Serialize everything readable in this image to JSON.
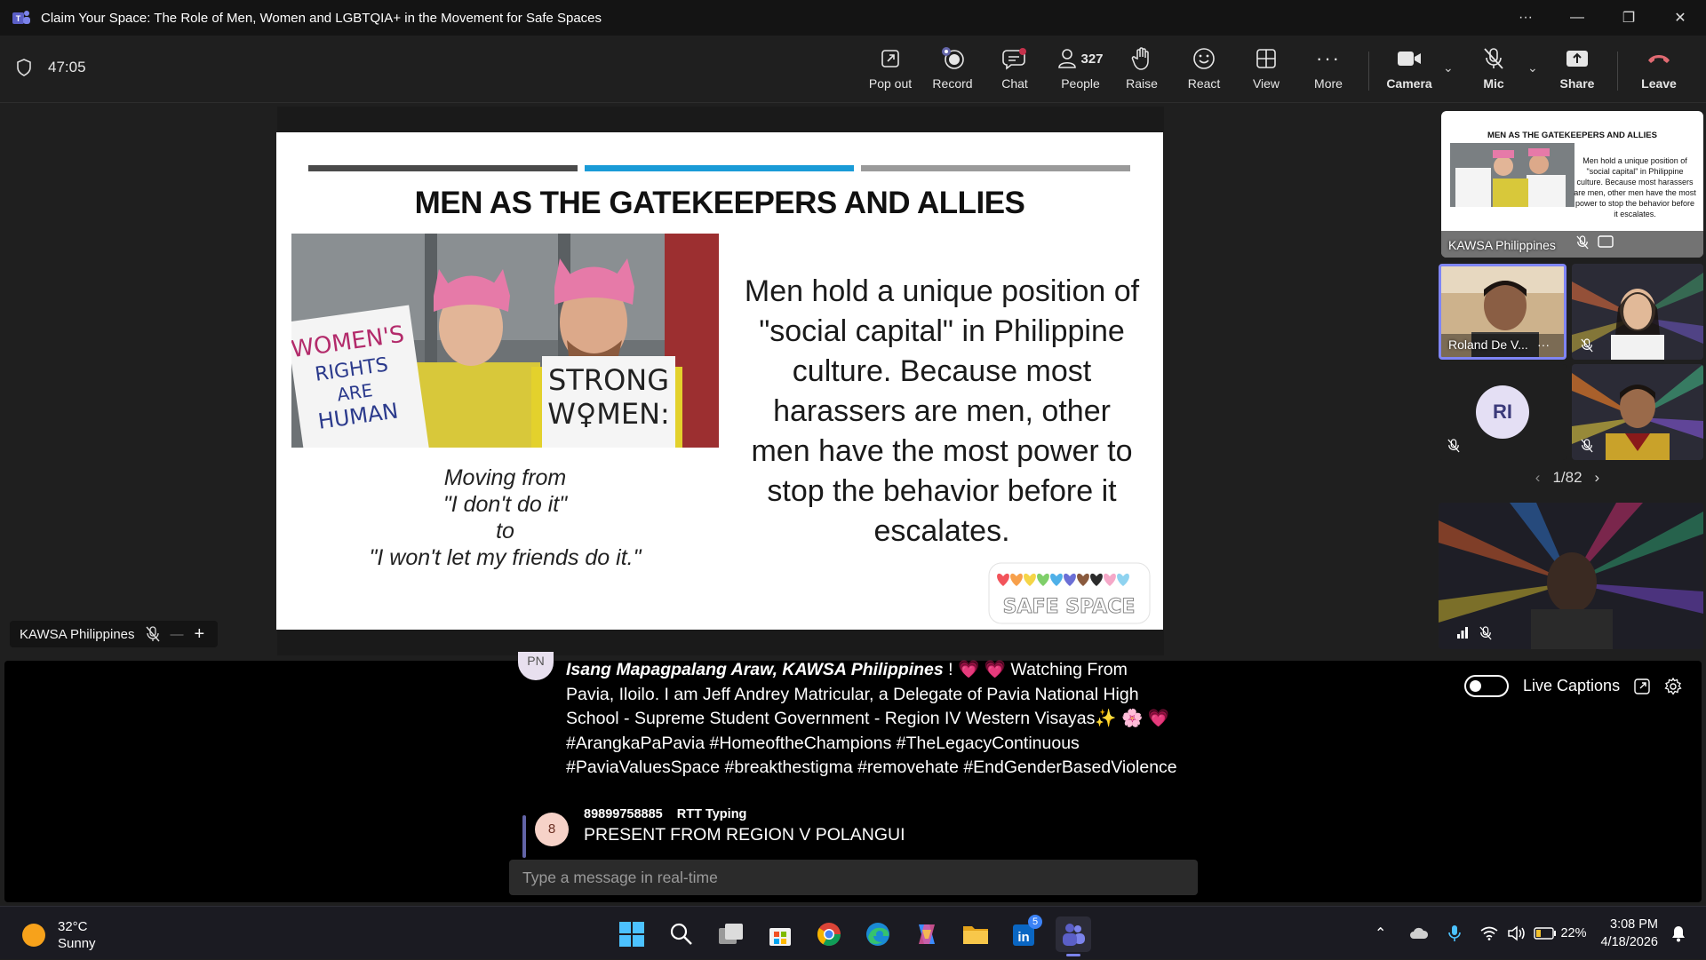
{
  "window": {
    "title": "Claim Your Space: The Role of Men, Women and LGBTQIA+ in the Movement for Safe Spaces",
    "controls": [
      "more-options",
      "minimize",
      "restore",
      "close"
    ]
  },
  "meeting": {
    "elapsed": "47:05",
    "people_count": "327"
  },
  "toolbar": {
    "popout": "Pop out",
    "record": "Record",
    "chat": "Chat",
    "people": "People",
    "raise": "Raise",
    "react": "React",
    "view": "View",
    "more": "More",
    "camera": "Camera",
    "mic": "Mic",
    "share": "Share",
    "leave": "Leave"
  },
  "slide": {
    "title": "MEN AS THE GATEKEEPERS AND ALLIES",
    "photo_sign_left": "WOMEN'S RIGHTS ARE HUMAN RIGHTS",
    "photo_sign_right": "STRONG W♀MEN:",
    "quote_lines": [
      "Moving from",
      "\"I don't do it\"",
      "to",
      "\"I won't let my friends do it.\""
    ],
    "body": "Men hold a unique position of \"social capital\" in Philippine culture. Because most harassers are men, other men have the most power to stop the behavior before it escalates.",
    "logo_text": "SAFE SPACE",
    "bar_colors": [
      "#4a4a4a",
      "#1a9bd7",
      "#9a9a9a"
    ]
  },
  "presenter_tag": {
    "name": "KAWSA Philippines"
  },
  "gallery": {
    "tiles": [
      {
        "name": "KAWSA Philippines",
        "thumb_title": "MEN AS THE GATEKEEPERS AND ALLIES",
        "thumb_text": "Men hold a unique position of \"social capital\" in Philippine culture. Because most harassers are men, other men have the most power to stop the behavior before it escalates."
      },
      {
        "name": "Roland De V..."
      },
      {
        "name": ""
      },
      {
        "initials": "RI"
      },
      {
        "name": ""
      },
      {
        "name": ""
      }
    ],
    "pager": "1/82"
  },
  "chat": {
    "msg1_avatar": "PN",
    "msg1_bold": "Isang Mapagpalang Araw, KAWSA Philippines",
    "msg1_text": "! 💗 💗  Watching From Pavia, Iloilo. I am Jeff Andrey Matricular, a Delegate of Pavia National High School - Supreme Student Government - Region IV Western Visayas✨ 🌸 💗  #ArangkaPaPavia #HomeoftheChampions #TheLegacyContinuous #PaviaValuesSpace #breakthestigma #removehate #EndGenderBasedViolence",
    "rtt_avatar": "8",
    "rtt_sender": "89899758885",
    "rtt_status": "RTT Typing",
    "rtt_message": "PRESENT FROM REGION V POLANGUI",
    "input_placeholder": "Type a message in real-time"
  },
  "captions": {
    "label": "Live Captions",
    "enabled": false
  },
  "taskbar": {
    "temp": "32°C",
    "condition": "Sunny",
    "battery": "22%",
    "time": "3:08 PM",
    "date": "4/18/2026",
    "linkedin_badge": "5"
  }
}
